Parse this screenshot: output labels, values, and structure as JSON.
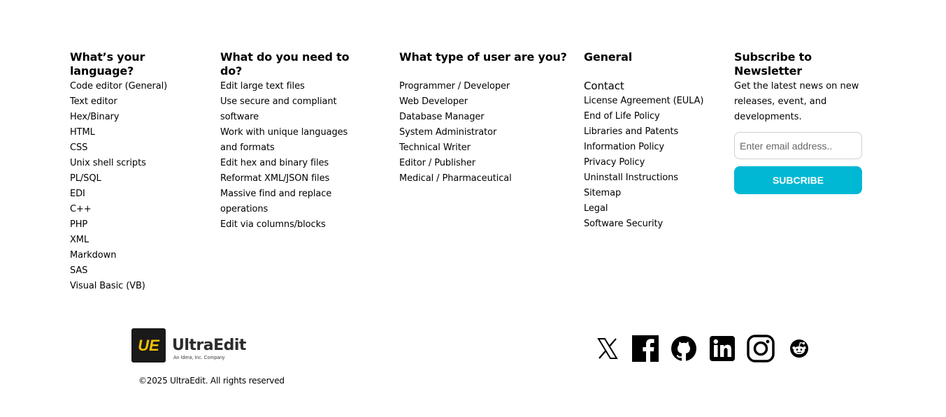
{
  "columns": {
    "language": {
      "title": "What’s your language?",
      "items": [
        "Code editor (General)",
        "Text editor",
        "Hex/Binary",
        "HTML",
        "CSS",
        "Unix shell scripts",
        "PL/SQL",
        "EDI",
        "C++",
        "PHP",
        "XML",
        "Markdown",
        "SAS",
        "Visual Basic (VB)"
      ]
    },
    "tasks": {
      "title": "What do you need to do?",
      "items": [
        "Edit large text files",
        "Use secure and compliant",
        "software",
        "Work with unique languages",
        "and formats",
        "Edit hex and binary files",
        "Reformat XML/JSON files",
        "Massive find and replace",
        "operations",
        "Edit via columns/blocks"
      ]
    },
    "users": {
      "title": "What type of user are you?",
      "items": [
        "Programmer / Developer",
        "Web Developer",
        "Database Manager",
        "System Administrator",
        "Technical Writer",
        "Editor / Publisher",
        "Medical / Pharmaceutical"
      ]
    },
    "general": {
      "title": "General",
      "items": [
        "Contact",
        "License Agreement (EULA)",
        "End of Life Policy",
        "Libraries and Patents",
        "Information Policy",
        "Privacy Policy",
        "Uninstall Instructions",
        "Sitemap",
        "Legal",
        "Software Security"
      ]
    }
  },
  "newsletter": {
    "title": "Subscribe to Newsletter",
    "description": "Get the latest news on new releases, event, and developments.",
    "email_placeholder": "Enter email address..",
    "button_label": "SUBCRIBE"
  },
  "brand": {
    "logo_initials": "UE",
    "name": "UltraEdit",
    "tagline": "An Idera, Inc. Company",
    "copyright": "©2025 UltraEdit. All rights reserved",
    "badge_color": "#f2c200"
  },
  "social": [
    "x-icon",
    "facebook-icon",
    "github-icon",
    "linkedin-icon",
    "instagram-icon",
    "reddit-icon"
  ],
  "colors": {
    "accent": "#00b8d4"
  }
}
